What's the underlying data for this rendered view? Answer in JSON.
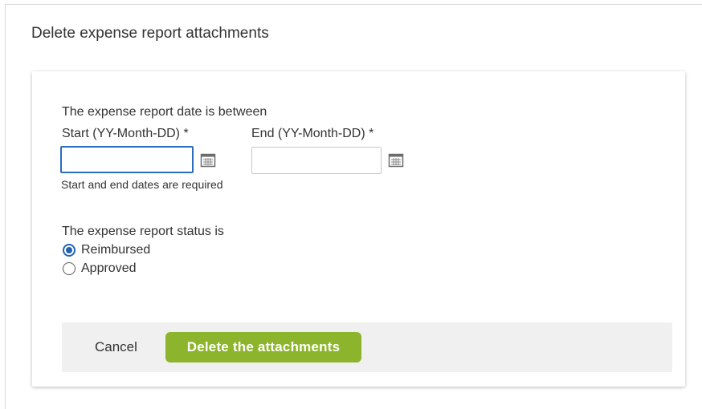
{
  "page": {
    "title": "Delete expense report attachments"
  },
  "date_section": {
    "heading": "The expense report date is between",
    "start_label": "Start (YY-Month-DD)  *",
    "end_label": "End (YY-Month-DD)  *",
    "start_value": "",
    "end_value": "",
    "validation_message": "Start and end dates are required",
    "calendar_icon": "calendar-icon"
  },
  "status_section": {
    "heading": "The expense report status is",
    "options": [
      {
        "label": "Reimbursed",
        "selected": true
      },
      {
        "label": "Approved",
        "selected": false
      }
    ]
  },
  "footer": {
    "cancel_label": "Cancel",
    "delete_label": "Delete the attachments"
  },
  "colors": {
    "primary_button": "#8db42d",
    "focus_border": "#2a6ebb",
    "radio_selected": "#1f63b8",
    "footer_background": "#f0f0f0"
  }
}
